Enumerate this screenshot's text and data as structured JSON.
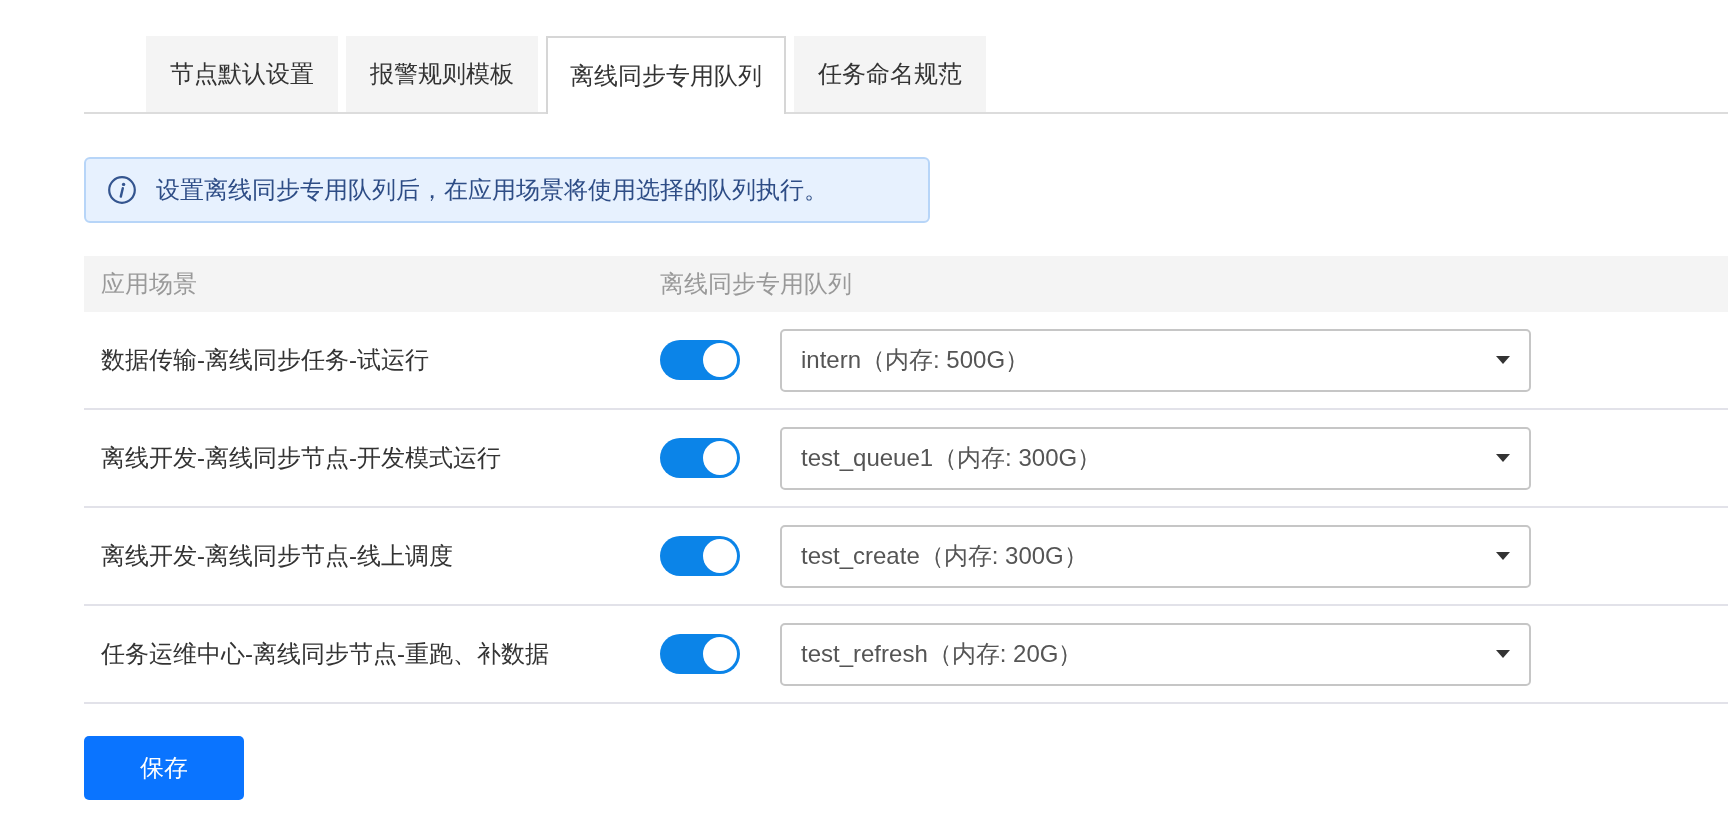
{
  "tabs": [
    {
      "label": "节点默认设置",
      "selected": false
    },
    {
      "label": "报警规则模板",
      "selected": false
    },
    {
      "label": "离线同步专用队列",
      "selected": true
    },
    {
      "label": "任务命名规范",
      "selected": false
    }
  ],
  "notice": {
    "text": "设置离线同步专用队列后，在应用场景将使用选择的队列执行。"
  },
  "table": {
    "columns": [
      "应用场景",
      "离线同步专用队列"
    ],
    "rows": [
      {
        "scenario": "数据传输-离线同步任务-试运行",
        "on": true,
        "queue": "intern（内存: 500G）"
      },
      {
        "scenario": "离线开发-离线同步节点-开发模式运行",
        "on": true,
        "queue": "test_queue1（内存: 300G）"
      },
      {
        "scenario": "离线开发-离线同步节点-线上调度",
        "on": true,
        "queue": "test_create（内存: 300G）"
      },
      {
        "scenario": "任务运维中心-离线同步节点-重跑、补数据",
        "on": true,
        "queue": "test_refresh（内存: 20G）"
      }
    ]
  },
  "save_button": {
    "label": "保存"
  }
}
